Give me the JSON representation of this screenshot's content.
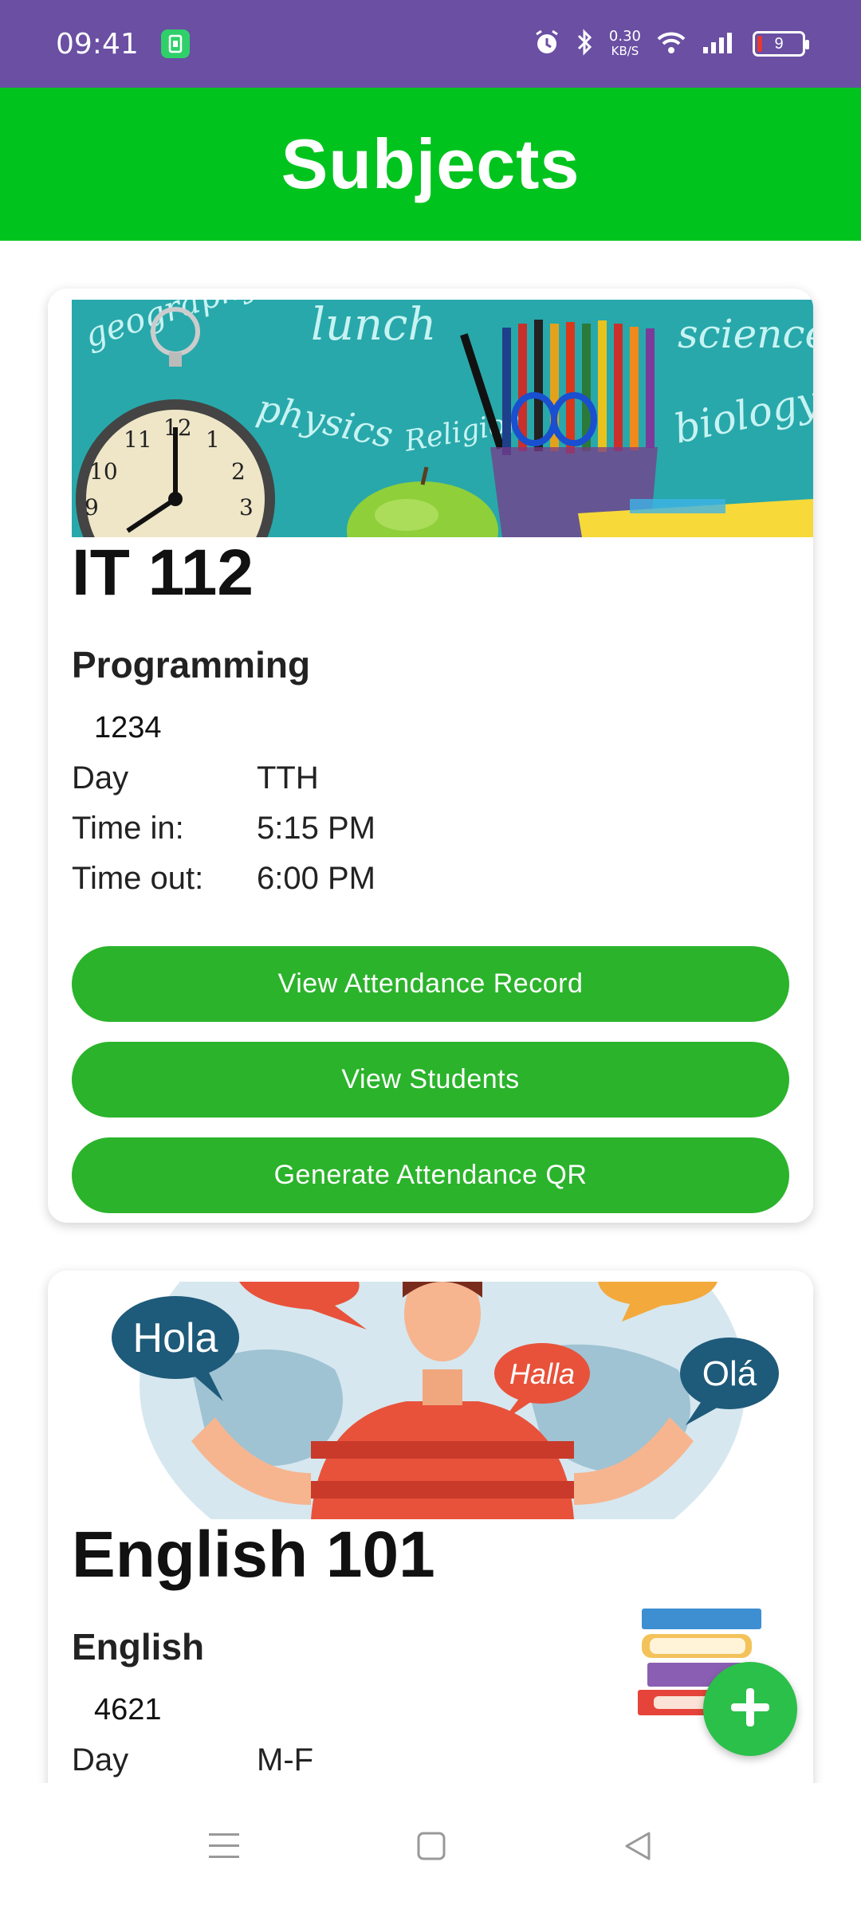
{
  "status_bar": {
    "time": "09:41",
    "speed_value": "0.30",
    "speed_unit": "KB/S",
    "battery": "9"
  },
  "app_bar": {
    "title": "Subjects"
  },
  "cards": [
    {
      "code": "IT 112",
      "subject": "Programming",
      "number": "1234",
      "day_label": "Day",
      "day_value": "TTH",
      "time_in_label": "Time in:",
      "time_in_value": "5:15 PM",
      "time_out_label": "Time out:",
      "time_out_value": "6:00 PM",
      "buttons": {
        "attendance_record": "View Attendance Record",
        "students": "View Students",
        "qr": "Generate Attendance QR"
      },
      "image_words": [
        "geography",
        "lunch",
        "physics",
        "Religion",
        "biology",
        "science"
      ]
    },
    {
      "code": "English 101",
      "subject": "English",
      "number": "4621",
      "day_label": "Day",
      "day_value": "M-F",
      "image_bubbles": [
        "Hola",
        "Halla",
        "Olá"
      ]
    }
  ],
  "colors": {
    "status_bar": "#6a4fa3",
    "app_bar": "#00c31e",
    "button": "#2bb32b",
    "fab": "#2bc04a"
  },
  "icons": [
    "app-notification-icon",
    "alarm-icon",
    "bluetooth-icon",
    "wifi-icon",
    "signal-icon",
    "battery-icon",
    "plus-icon",
    "menu-icon",
    "home-icon",
    "back-icon"
  ]
}
